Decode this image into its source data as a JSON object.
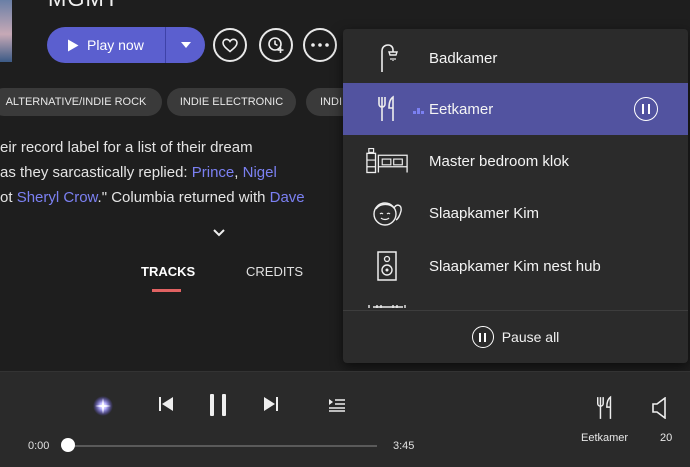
{
  "artist": {
    "name": "MGMT"
  },
  "actions": {
    "play_label": "Play now"
  },
  "genres": [
    "ALTERNATIVE/INDIE ROCK",
    "INDIE ELECTRONIC",
    "INDI"
  ],
  "bio": {
    "line1": "eir record label for a list of their dream",
    "line2_pre": "as they sarcastically replied: ",
    "line2_link1": "Prince",
    "line2_sep": ", ",
    "line2_link2": "Nigel",
    "line3_pre": "ot ",
    "line3_link1": "Sheryl Crow",
    "line3_mid": ".\" Columbia returned with ",
    "line3_link2": "Dave"
  },
  "tabs": [
    {
      "label": "TRACKS",
      "active": true
    },
    {
      "label": "CREDITS",
      "active": false
    }
  ],
  "rooms_menu": {
    "items": [
      {
        "label": "Badkamer",
        "icon": "shower-icon",
        "active": false
      },
      {
        "label": "Eetkamer",
        "icon": "fork-knife-icon",
        "active": true
      },
      {
        "label": "Master bedroom klok",
        "icon": "bedroom-icon",
        "active": false
      },
      {
        "label": "Slaapkamer Kim",
        "icon": "child-face-icon",
        "active": false
      },
      {
        "label": "Slaapkamer Kim nest hub",
        "icon": "speaker-icon",
        "active": false
      }
    ],
    "pause_all_label": "Pause all"
  },
  "player": {
    "elapsed": "0:00",
    "duration": "3:45",
    "progress": 0.0,
    "room": "Eetkamer",
    "volume": "20"
  },
  "colors": {
    "accent": "#5b5fcf",
    "link": "#7b80f2",
    "tab_underline": "#e06262",
    "menu_active": "#5253a0"
  }
}
